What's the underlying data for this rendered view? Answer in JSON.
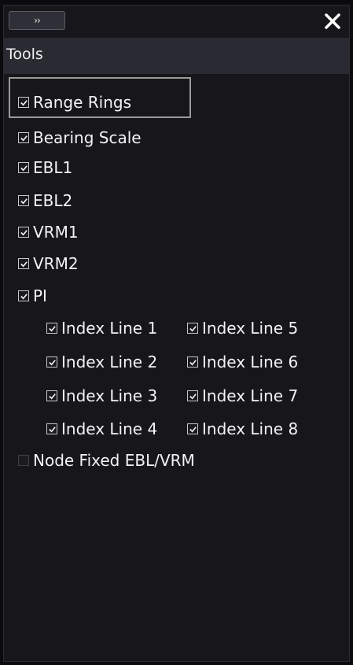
{
  "header": {
    "expand_label": "››",
    "close_label": "✕"
  },
  "panel": {
    "title": "Tools"
  },
  "items": [
    {
      "label": "Range Rings",
      "checked": true
    },
    {
      "label": "Bearing Scale",
      "checked": true
    },
    {
      "label": "EBL1",
      "checked": true
    },
    {
      "label": "EBL2",
      "checked": true
    },
    {
      "label": "VRM1",
      "checked": true
    },
    {
      "label": "VRM2",
      "checked": true
    },
    {
      "label": "PI",
      "checked": true
    },
    {
      "label": "Index Line 1",
      "checked": true
    },
    {
      "label": "Index Line 5",
      "checked": true
    },
    {
      "label": "Index Line 2",
      "checked": true
    },
    {
      "label": "Index Line 6",
      "checked": true
    },
    {
      "label": "Index Line 3",
      "checked": true
    },
    {
      "label": "Index Line 7",
      "checked": true
    },
    {
      "label": "Index Line 4",
      "checked": true
    },
    {
      "label": "Index Line 8",
      "checked": true
    },
    {
      "label": "Node Fixed EBL/VRM",
      "checked": false
    }
  ],
  "colors": {
    "background": "#17171b",
    "text": "#f3f3f3",
    "highlight": "#9a9a9a"
  }
}
